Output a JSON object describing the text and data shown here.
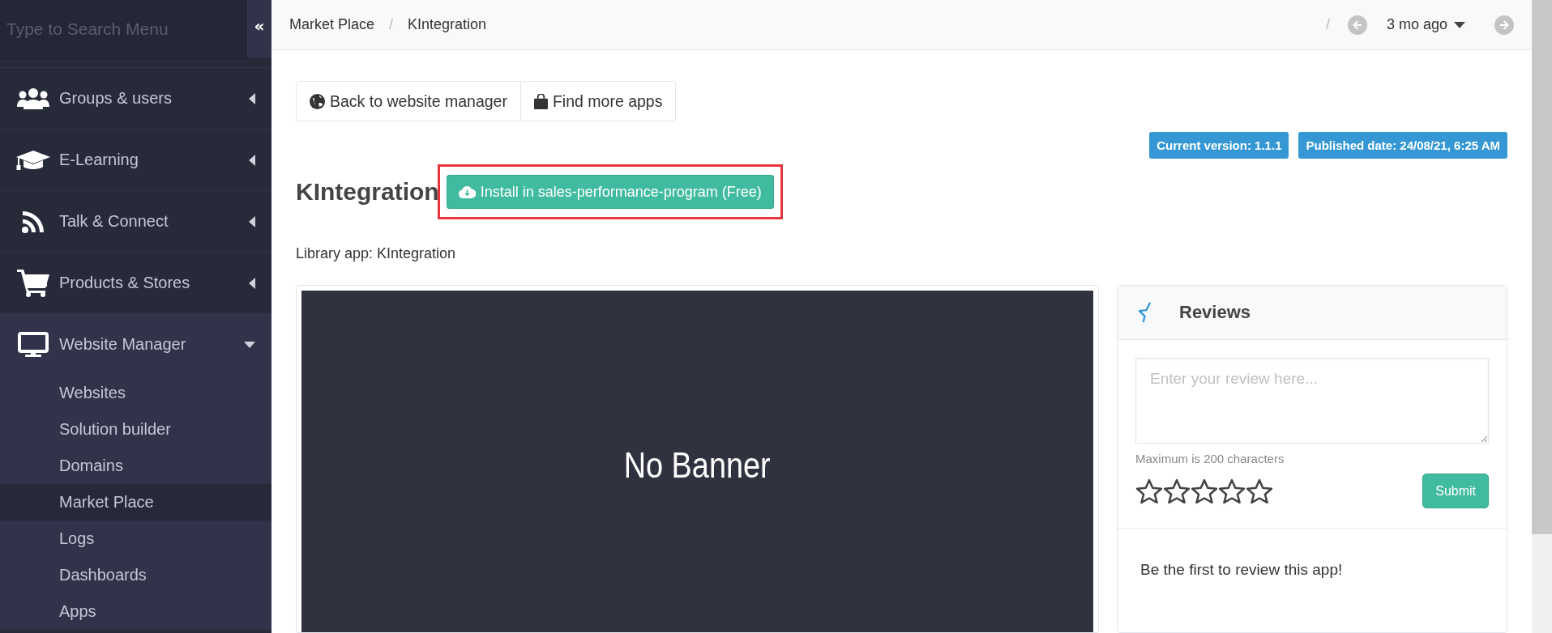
{
  "sidebar": {
    "search": {
      "placeholder": "Type to Search Menu"
    },
    "collapse_button": "«",
    "items": [
      {
        "label": "Groups & users",
        "expanded": false
      },
      {
        "label": "E-Learning",
        "expanded": false
      },
      {
        "label": "Talk & Connect",
        "expanded": false
      },
      {
        "label": "Products & Stores",
        "expanded": false
      },
      {
        "label": "Website Manager",
        "expanded": true,
        "children": [
          {
            "label": "Websites",
            "selected": false
          },
          {
            "label": "Solution builder",
            "selected": false
          },
          {
            "label": "Domains",
            "selected": false
          },
          {
            "label": "Market Place",
            "selected": true
          },
          {
            "label": "Logs",
            "selected": false
          },
          {
            "label": "Dashboards",
            "selected": false
          },
          {
            "label": "Apps",
            "selected": false
          }
        ]
      }
    ]
  },
  "header": {
    "breadcrumb": [
      {
        "kind": "link",
        "label": "Market Place"
      },
      {
        "kind": "separator",
        "label": "/"
      },
      {
        "kind": "current",
        "label": "KIntegration"
      }
    ],
    "separator": "/",
    "history": {
      "label": "3 mo ago"
    }
  },
  "toolbar": [
    {
      "label": "Back to website manager"
    },
    {
      "label": "Find more apps"
    }
  ],
  "badges": [
    "Current version: 1.1.1",
    "Published date: 24/08/21, 6:25 AM"
  ],
  "app": {
    "title": "KIntegration",
    "install_button": "Install in sales-performance-program (Free)",
    "highlighted": true,
    "library_label": "Library app: KIntegration",
    "banner": "No Banner"
  },
  "reviews": {
    "title": "Reviews",
    "placeholder": "Enter your review here...",
    "hint": "Maximum is 200 characters",
    "stars": 0,
    "submit": "Submit",
    "empty_message": "Be the first to review this app!"
  }
}
